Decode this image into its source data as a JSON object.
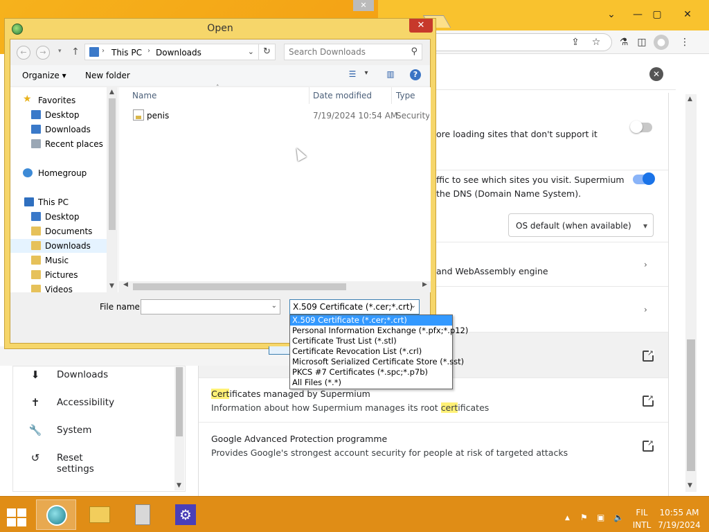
{
  "dialog": {
    "title": "Open",
    "path": [
      "This PC",
      "Downloads"
    ],
    "search_placeholder": "Search Downloads",
    "toolbar": {
      "organize": "Organize ▾",
      "new_folder": "New folder"
    },
    "tree": {
      "favorites": "Favorites",
      "fav_items": [
        "Desktop",
        "Downloads",
        "Recent places"
      ],
      "homegroup": "Homegroup",
      "this_pc": "This PC",
      "pc_items": [
        "Desktop",
        "Documents",
        "Downloads",
        "Music",
        "Pictures",
        "Videos"
      ]
    },
    "columns": {
      "name": "Name",
      "date": "Date modified",
      "type": "Type"
    },
    "files": [
      {
        "name": "penis",
        "date": "7/19/2024 10:54 AM",
        "type": "Security Certificate"
      }
    ],
    "file_name_label": "File name:",
    "file_name_value": "",
    "file_type_selected": "X.509 Certificate (*.cer;*.crt)",
    "file_type_options": [
      "X.509 Certificate (*.cer;*.crt)",
      "Personal Information Exchange (*.pfx;*.p12)",
      "Certificate Trust List (*.stl)",
      "Certificate Revocation List (*.crl)",
      "Microsoft Serialized Certificate Store (*.sst)",
      "PKCS #7 Certificates (*.spc;*.p7b)",
      "All Files (*.*)"
    ]
  },
  "settings": {
    "row1_text": "ore loading sites that don't support it",
    "row2_line1": "ffic to see which sites you visit. Supermium",
    "row2_line2": "the DNS (Domain Name System).",
    "dns_select": "OS default (when available)",
    "row3_text": "and WebAssembly engine",
    "cert_title_hl": "Cert",
    "cert_title_rest": "ificates managed by Supermium",
    "cert_sub_pre": "Information about how Supermium manages its root ",
    "cert_sub_hl": "cert",
    "cert_sub_post": "ificates",
    "gap_title": "Google Advanced Protection programme",
    "gap_sub": "Provides Google's strongest account security for people at risk of targeted attacks"
  },
  "sidebar": {
    "items": [
      {
        "label": "Downloads",
        "icon": "download-icon"
      },
      {
        "label": "Accessibility",
        "icon": "accessibility-icon"
      },
      {
        "label": "System",
        "icon": "wrench-icon"
      },
      {
        "label": "Reset settings",
        "icon": "reset-icon"
      }
    ]
  },
  "taskbar": {
    "lang": "FIL",
    "layout": "INTL",
    "time": "10:55 AM",
    "date": "7/19/2024"
  },
  "colors": {
    "accent": "#1a73e8",
    "taskbar": "#e08d16",
    "dialog_frame": "#f6d66a",
    "highlight": "#fff176",
    "selection": "#3399ff"
  }
}
